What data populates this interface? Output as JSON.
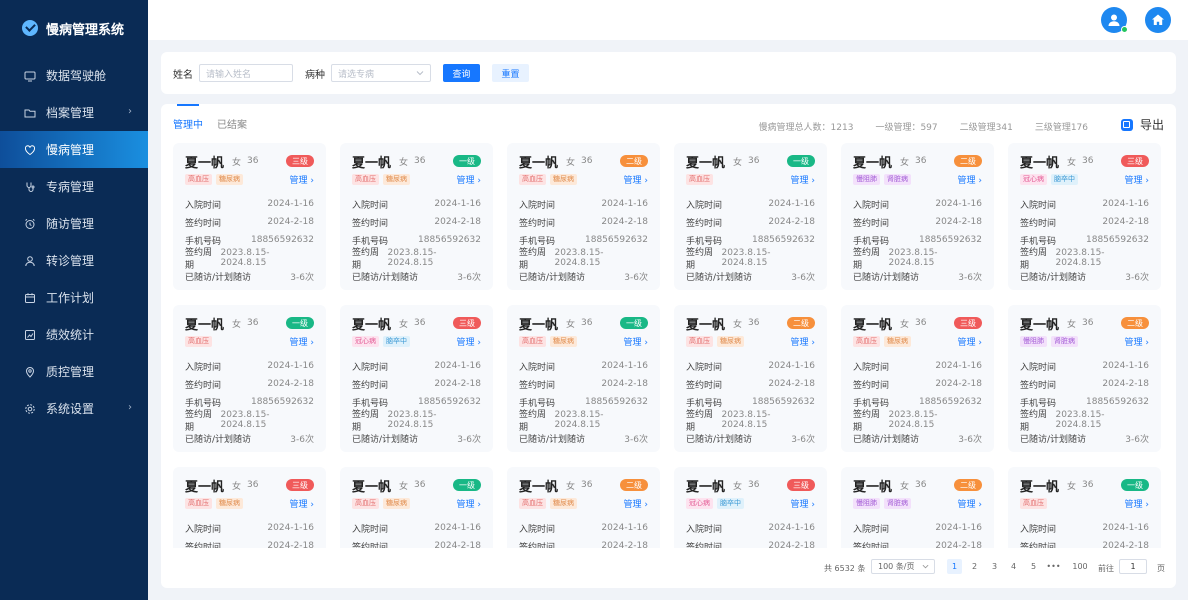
{
  "app": {
    "title": "慢病管理系统"
  },
  "sidebar": {
    "items": [
      {
        "label": "数据驾驶舱",
        "icon": "monitor-icon",
        "arrow": false,
        "active": false
      },
      {
        "label": "档案管理",
        "icon": "folder-icon",
        "arrow": true,
        "active": false
      },
      {
        "label": "慢病管理",
        "icon": "heart-icon",
        "arrow": false,
        "active": true
      },
      {
        "label": "专病管理",
        "icon": "stethoscope-icon",
        "arrow": false,
        "active": false
      },
      {
        "label": "随访管理",
        "icon": "alarm-icon",
        "arrow": false,
        "active": false
      },
      {
        "label": "转诊管理",
        "icon": "user-icon",
        "arrow": false,
        "active": false
      },
      {
        "label": "工作计划",
        "icon": "calendar-icon",
        "arrow": false,
        "active": false
      },
      {
        "label": "绩效统计",
        "icon": "chart-icon",
        "arrow": false,
        "active": false
      },
      {
        "label": "质控管理",
        "icon": "location-icon",
        "arrow": false,
        "active": false
      },
      {
        "label": "系统设置",
        "icon": "gear-icon",
        "arrow": true,
        "active": false
      }
    ]
  },
  "topbar": {
    "avatar_icon": "user-avatar-icon",
    "home_icon": "home-icon"
  },
  "filter": {
    "name_label": "姓名",
    "name_placeholder": "请输入姓名",
    "disease_label": "病种",
    "disease_placeholder": "请选专病",
    "search_label": "查询",
    "reset_label": "重置"
  },
  "tabs": {
    "managing": "管理中",
    "closed": "已结案"
  },
  "stats": {
    "total": "慢病管理总人数：1213",
    "level1": "一级管理：597",
    "level2": "二级管理341",
    "level3": "三级管理176"
  },
  "export_label": "导出",
  "colors": {
    "level_一级": "#19b886",
    "level_二级": "#f7903c",
    "level_三级": "#f05a5a",
    "tag_高血压": "#fde3e3|#e26b6b",
    "tag_糖尿病": "#fde9d9|#e08a4a",
    "tag_慢阻肺": "#f3e1fb|#a25ad6",
    "tag_肾脏病": "#f3e1fb|#a25ad6",
    "tag_冠心病": "#fde3ef|#e35b95",
    "tag_脑卒中": "#dff1fb|#3a98d4"
  },
  "card_labels": {
    "admit": "入院时间",
    "sign": "签约时间",
    "phone": "手机号码",
    "period": "签约周期",
    "visits": "已随访/计划随访",
    "manage": "管理 ›"
  },
  "cards": [
    {
      "name": "夏一帆",
      "sex": "女",
      "age": "36",
      "level": "三级",
      "tags": [
        "高血压",
        "糖尿病"
      ],
      "admit": "2024-1-16",
      "sign": "2024-2-18",
      "phone": "18856592632",
      "period": "2023.8.15-2024.8.15",
      "visits": "3-6次"
    },
    {
      "name": "夏一帆",
      "sex": "女",
      "age": "36",
      "level": "一级",
      "tags": [
        "高血压",
        "糖尿病"
      ],
      "admit": "2024-1-16",
      "sign": "2024-2-18",
      "phone": "18856592632",
      "period": "2023.8.15-2024.8.15",
      "visits": "3-6次"
    },
    {
      "name": "夏一帆",
      "sex": "女",
      "age": "36",
      "level": "二级",
      "tags": [
        "高血压",
        "糖尿病"
      ],
      "admit": "2024-1-16",
      "sign": "2024-2-18",
      "phone": "18856592632",
      "period": "2023.8.15-2024.8.15",
      "visits": "3-6次"
    },
    {
      "name": "夏一帆",
      "sex": "女",
      "age": "36",
      "level": "一级",
      "tags": [
        "高血压"
      ],
      "admit": "2024-1-16",
      "sign": "2024-2-18",
      "phone": "18856592632",
      "period": "2023.8.15-2024.8.15",
      "visits": "3-6次"
    },
    {
      "name": "夏一帆",
      "sex": "女",
      "age": "36",
      "level": "二级",
      "tags": [
        "慢阻肺",
        "肾脏病"
      ],
      "admit": "2024-1-16",
      "sign": "2024-2-18",
      "phone": "18856592632",
      "period": "2023.8.15-2024.8.15",
      "visits": "3-6次"
    },
    {
      "name": "夏一帆",
      "sex": "女",
      "age": "36",
      "level": "三级",
      "tags": [
        "冠心病",
        "脑卒中"
      ],
      "admit": "2024-1-16",
      "sign": "2024-2-18",
      "phone": "18856592632",
      "period": "2023.8.15-2024.8.15",
      "visits": "3-6次"
    },
    {
      "name": "夏一帆",
      "sex": "女",
      "age": "36",
      "level": "一级",
      "tags": [
        "高血压"
      ],
      "admit": "2024-1-16",
      "sign": "2024-2-18",
      "phone": "18856592632",
      "period": "2023.8.15-2024.8.15",
      "visits": "3-6次"
    },
    {
      "name": "夏一帆",
      "sex": "女",
      "age": "36",
      "level": "三级",
      "tags": [
        "冠心病",
        "脑卒中"
      ],
      "admit": "2024-1-16",
      "sign": "2024-2-18",
      "phone": "18856592632",
      "period": "2023.8.15-2024.8.15",
      "visits": "3-6次"
    },
    {
      "name": "夏一帆",
      "sex": "女",
      "age": "36",
      "level": "一级",
      "tags": [
        "高血压",
        "糖尿病"
      ],
      "admit": "2024-1-16",
      "sign": "2024-2-18",
      "phone": "18856592632",
      "period": "2023.8.15-2024.8.15",
      "visits": "3-6次"
    },
    {
      "name": "夏一帆",
      "sex": "女",
      "age": "36",
      "level": "二级",
      "tags": [
        "高血压",
        "糖尿病"
      ],
      "admit": "2024-1-16",
      "sign": "2024-2-18",
      "phone": "18856592632",
      "period": "2023.8.15-2024.8.15",
      "visits": "3-6次"
    },
    {
      "name": "夏一帆",
      "sex": "女",
      "age": "36",
      "level": "三级",
      "tags": [
        "高血压",
        "糖尿病"
      ],
      "admit": "2024-1-16",
      "sign": "2024-2-18",
      "phone": "18856592632",
      "period": "2023.8.15-2024.8.15",
      "visits": "3-6次"
    },
    {
      "name": "夏一帆",
      "sex": "女",
      "age": "36",
      "level": "二级",
      "tags": [
        "慢阻肺",
        "肾脏病"
      ],
      "admit": "2024-1-16",
      "sign": "2024-2-18",
      "phone": "18856592632",
      "period": "2023.8.15-2024.8.15",
      "visits": "3-6次"
    },
    {
      "name": "夏一帆",
      "sex": "女",
      "age": "36",
      "level": "三级",
      "tags": [
        "高血压",
        "糖尿病"
      ],
      "admit": "2024-1-16",
      "sign": "2024-2-18"
    },
    {
      "name": "夏一帆",
      "sex": "女",
      "age": "36",
      "level": "一级",
      "tags": [
        "高血压",
        "糖尿病"
      ],
      "admit": "2024-1-16",
      "sign": "2024-2-18"
    },
    {
      "name": "夏一帆",
      "sex": "女",
      "age": "36",
      "level": "二级",
      "tags": [
        "高血压",
        "糖尿病"
      ],
      "admit": "2024-1-16",
      "sign": "2024-2-18"
    },
    {
      "name": "夏一帆",
      "sex": "女",
      "age": "36",
      "level": "三级",
      "tags": [
        "冠心病",
        "脑卒中"
      ],
      "admit": "2024-1-16",
      "sign": "2024-2-18"
    },
    {
      "name": "夏一帆",
      "sex": "女",
      "age": "36",
      "level": "二级",
      "tags": [
        "慢阻肺",
        "肾脏病"
      ],
      "admit": "2024-1-16",
      "sign": "2024-2-18"
    },
    {
      "name": "夏一帆",
      "sex": "女",
      "age": "36",
      "level": "一级",
      "tags": [
        "高血压"
      ],
      "admit": "2024-1-16",
      "sign": "2024-2-18"
    }
  ],
  "pagination": {
    "total": "共 6532 条",
    "page_size": "100 条/页",
    "pages": [
      "1",
      "2",
      "3",
      "4",
      "5",
      "•••",
      "100"
    ],
    "current": "1",
    "goto_label": "前往",
    "goto_value": "1",
    "unit": "页"
  }
}
